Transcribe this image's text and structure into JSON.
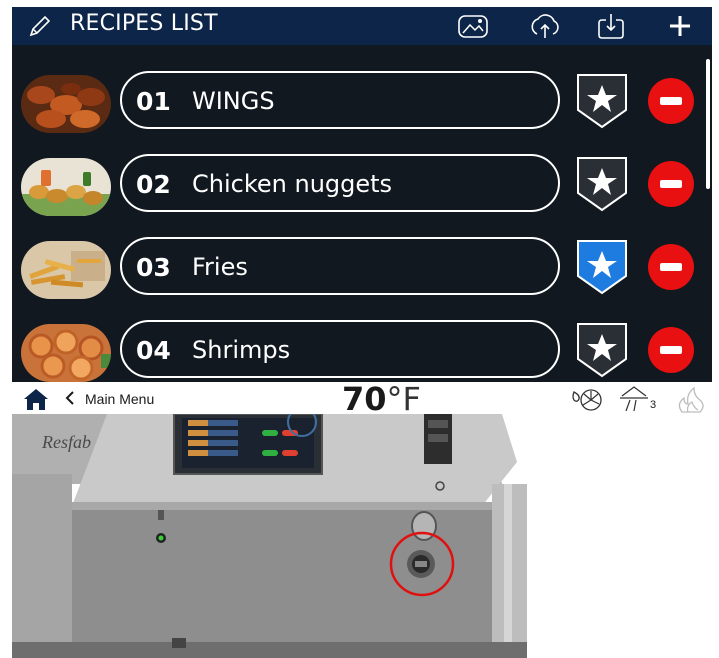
{
  "header": {
    "title": "RECIPES LIST",
    "icons": [
      "pencil-icon",
      "image-icon",
      "upload-icon",
      "download-icon",
      "plus-icon"
    ]
  },
  "recipes": [
    {
      "number": "01",
      "name": "WINGS",
      "favorite": false,
      "thumb": "wings"
    },
    {
      "number": "02",
      "name": "Chicken nuggets",
      "favorite": false,
      "thumb": "nuggets"
    },
    {
      "number": "03",
      "name": "Fries",
      "favorite": true,
      "thumb": "fries"
    },
    {
      "number": "04",
      "name": "Shrimps",
      "favorite": false,
      "thumb": "shrimps"
    }
  ],
  "statusbar": {
    "back_label": "Main Menu",
    "temperature": "70",
    "temperature_unit": "°F",
    "badge_count": "3",
    "icons": [
      "home-icon",
      "chevron-left-icon",
      "fan-water-icon",
      "drain-icon",
      "fire-icon"
    ]
  },
  "photo": {
    "brand": "Resfab"
  },
  "colors": {
    "header": "#0d2548",
    "screen": "#111820",
    "remove": "#e81010",
    "favorite_active": "#1e7be0",
    "annotation": "#e01010"
  }
}
